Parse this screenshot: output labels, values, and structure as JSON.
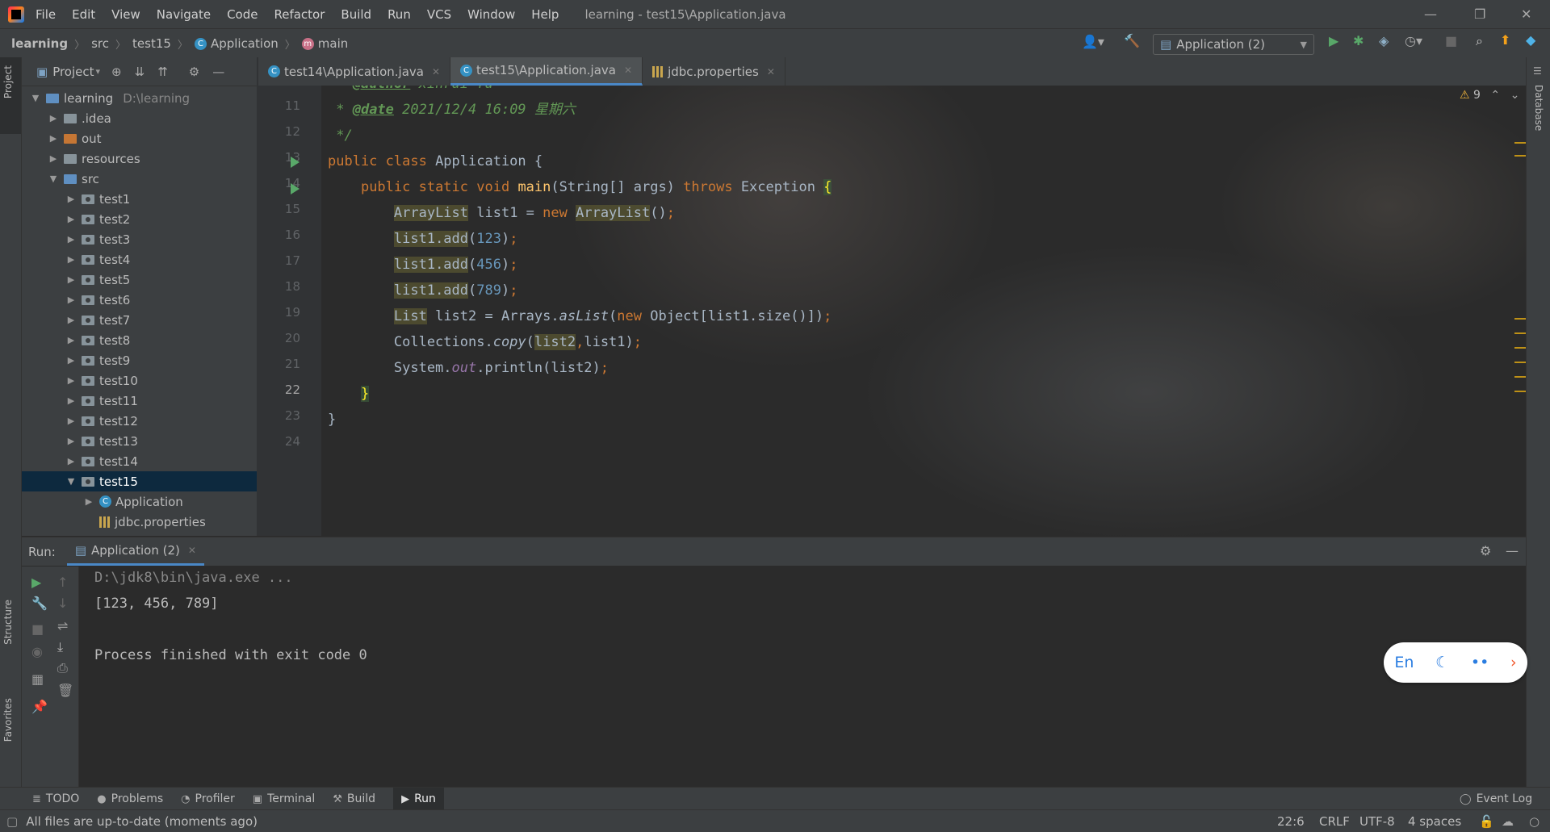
{
  "menubar": {
    "items": [
      "File",
      "Edit",
      "View",
      "Navigate",
      "Code",
      "Refactor",
      "Build",
      "Run",
      "VCS",
      "Window",
      "Help"
    ],
    "window_title": "learning - test15\\Application.java"
  },
  "navbar": {
    "crumbs": [
      "learning",
      "src",
      "test15",
      "Application",
      "main"
    ],
    "run_config": "Application (2)"
  },
  "project": {
    "title": "Project",
    "tree": [
      {
        "label": "learning",
        "hint": "D:\\learning",
        "indent": 0,
        "arrow": "down",
        "icon": "blue"
      },
      {
        "label": ".idea",
        "indent": 1,
        "arrow": "right",
        "icon": "grey"
      },
      {
        "label": "out",
        "indent": 1,
        "arrow": "right",
        "icon": "orange"
      },
      {
        "label": "resources",
        "indent": 1,
        "arrow": "right",
        "icon": "grey"
      },
      {
        "label": "src",
        "indent": 1,
        "arrow": "down",
        "icon": "blue"
      },
      {
        "label": "test1",
        "indent": 2,
        "arrow": "right",
        "icon": "pkg"
      },
      {
        "label": "test2",
        "indent": 2,
        "arrow": "right",
        "icon": "pkg"
      },
      {
        "label": "test3",
        "indent": 2,
        "arrow": "right",
        "icon": "pkg"
      },
      {
        "label": "test4",
        "indent": 2,
        "arrow": "right",
        "icon": "pkg"
      },
      {
        "label": "test5",
        "indent": 2,
        "arrow": "right",
        "icon": "pkg"
      },
      {
        "label": "test6",
        "indent": 2,
        "arrow": "right",
        "icon": "pkg"
      },
      {
        "label": "test7",
        "indent": 2,
        "arrow": "right",
        "icon": "pkg"
      },
      {
        "label": "test8",
        "indent": 2,
        "arrow": "right",
        "icon": "pkg"
      },
      {
        "label": "test9",
        "indent": 2,
        "arrow": "right",
        "icon": "pkg"
      },
      {
        "label": "test10",
        "indent": 2,
        "arrow": "right",
        "icon": "pkg"
      },
      {
        "label": "test11",
        "indent": 2,
        "arrow": "right",
        "icon": "pkg"
      },
      {
        "label": "test12",
        "indent": 2,
        "arrow": "right",
        "icon": "pkg"
      },
      {
        "label": "test13",
        "indent": 2,
        "arrow": "right",
        "icon": "pkg"
      },
      {
        "label": "test14",
        "indent": 2,
        "arrow": "right",
        "icon": "pkg"
      },
      {
        "label": "test15",
        "indent": 2,
        "arrow": "down",
        "icon": "pkg",
        "selected": true
      },
      {
        "label": "Application",
        "indent": 3,
        "arrow": "right",
        "icon": "class"
      },
      {
        "label": "jdbc.properties",
        "indent": 3,
        "arrow": "",
        "icon": "props"
      }
    ]
  },
  "tabs": [
    {
      "label": "test14\\Application.java",
      "icon": "class",
      "active": false
    },
    {
      "label": "test15\\Application.java",
      "icon": "class",
      "active": true
    },
    {
      "label": "jdbc.properties",
      "icon": "props",
      "active": false
    }
  ],
  "editor": {
    "line_numbers": [
      "11",
      "12",
      "13",
      "14",
      "15",
      "16",
      "17",
      "18",
      "19",
      "20",
      "21",
      "22",
      "23",
      "24"
    ],
    "current_line": "22",
    "warnings": "9"
  },
  "run": {
    "label": "Run:",
    "tab": "Application (2)",
    "console": [
      "D:\\jdk8\\bin\\java.exe ...",
      "[123, 456, 789]",
      "",
      "Process finished with exit code 0"
    ]
  },
  "ime": {
    "lang": "En"
  },
  "side_labels": {
    "project": "Project",
    "structure": "Structure",
    "favorites": "Favorites",
    "database": "Database"
  },
  "bottom_tools": [
    {
      "label": "TODO",
      "icon": "≣"
    },
    {
      "label": "Problems",
      "icon": "●"
    },
    {
      "label": "Profiler",
      "icon": "◔"
    },
    {
      "label": "Terminal",
      "icon": "▣"
    },
    {
      "label": "Build",
      "icon": "⚒"
    },
    {
      "label": "Run",
      "icon": "▶",
      "active": true
    }
  ],
  "event_log": "Event Log",
  "status": {
    "message": "All files are up-to-date (moments ago)",
    "position": "22:6",
    "line_sep": "CRLF",
    "encoding": "UTF-8",
    "indent": "4 spaces"
  }
}
